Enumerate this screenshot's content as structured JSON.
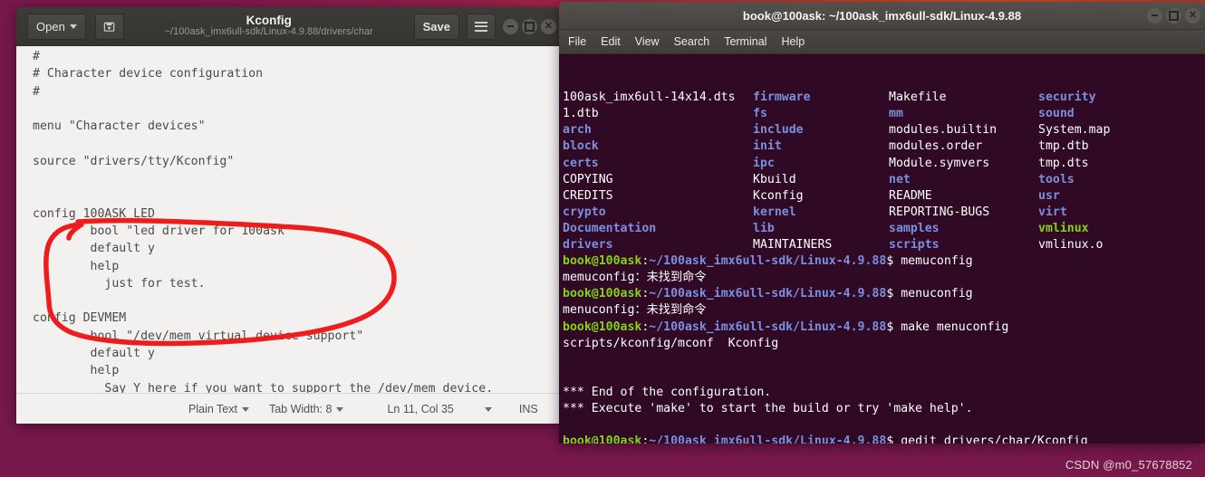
{
  "desktop": {
    "watermark": "CSDN @m0_57678852"
  },
  "gedit": {
    "title": "Kconfig",
    "subtitle": "~/100ask_imx6ull-sdk/Linux-4.9.88/drivers/char",
    "open_label": "Open",
    "save_label": "Save",
    "icons": {
      "new_document": "new-document-icon",
      "menu": "hamburger-menu-icon",
      "open_caret": "chevron-down-icon"
    },
    "window_controls": {
      "minimize": "minimize-icon",
      "maximize": "maximize-icon",
      "close": "close-icon"
    },
    "document_text": "#\n# Character device configuration\n#\n\nmenu \"Character devices\"\n\nsource \"drivers/tty/Kconfig\"\n\n\nconfig 100ASK_LED\n        bool \"led driver for 100ask\"\n        default y\n        help\n          just for test.\n\nconfig DEVMEM\n        bool \"/dev/mem virtual device support\"\n        default y\n        help\n          Say Y here if you want to support the /dev/mem device.\n          The /dev/mem device is used to access areas of physical\n          memory.",
    "statusbar": {
      "language": "Plain Text",
      "tab_width": "Tab Width: 8",
      "cursor_position": "Ln 11, Col 35",
      "insert_mode": "INS"
    },
    "annotation": {
      "shape": "hand-drawn-red-ellipse",
      "color": "#ee1c1c",
      "encircles": "config 100ASK_LED block"
    }
  },
  "terminal": {
    "title": "book@100ask: ~/100ask_imx6ull-sdk/Linux-4.9.88",
    "menu": [
      "File",
      "Edit",
      "View",
      "Search",
      "Terminal",
      "Help"
    ],
    "window_controls": {
      "minimize": "minimize-icon",
      "maximize": "maximize-icon",
      "close": "close-icon"
    },
    "prompt": {
      "user_host": "book@100ask",
      "separator": ":",
      "path": "~/100ask_imx6ull-sdk/Linux-4.9.88",
      "sigil": "$"
    },
    "ls_output": [
      [
        {
          "name": "100ask_imx6ull-14x14.dts",
          "type": "file"
        },
        {
          "name": "firmware",
          "type": "dir"
        },
        {
          "name": "Makefile",
          "type": "file"
        },
        {
          "name": "security",
          "type": "dir"
        }
      ],
      [
        {
          "name": "1.dtb",
          "type": "file"
        },
        {
          "name": "fs",
          "type": "dir"
        },
        {
          "name": "mm",
          "type": "dir"
        },
        {
          "name": "sound",
          "type": "dir"
        }
      ],
      [
        {
          "name": "arch",
          "type": "dir"
        },
        {
          "name": "include",
          "type": "dir"
        },
        {
          "name": "modules.builtin",
          "type": "file"
        },
        {
          "name": "System.map",
          "type": "file"
        }
      ],
      [
        {
          "name": "block",
          "type": "dir"
        },
        {
          "name": "init",
          "type": "dir"
        },
        {
          "name": "modules.order",
          "type": "file"
        },
        {
          "name": "tmp.dtb",
          "type": "file"
        }
      ],
      [
        {
          "name": "certs",
          "type": "dir"
        },
        {
          "name": "ipc",
          "type": "dir"
        },
        {
          "name": "Module.symvers",
          "type": "file"
        },
        {
          "name": "tmp.dts",
          "type": "file"
        }
      ],
      [
        {
          "name": "COPYING",
          "type": "file"
        },
        {
          "name": "Kbuild",
          "type": "file"
        },
        {
          "name": "net",
          "type": "dir"
        },
        {
          "name": "tools",
          "type": "dir"
        }
      ],
      [
        {
          "name": "CREDITS",
          "type": "file"
        },
        {
          "name": "Kconfig",
          "type": "file"
        },
        {
          "name": "README",
          "type": "file"
        },
        {
          "name": "usr",
          "type": "dir"
        }
      ],
      [
        {
          "name": "crypto",
          "type": "dir"
        },
        {
          "name": "kernel",
          "type": "dir"
        },
        {
          "name": "REPORTING-BUGS",
          "type": "file"
        },
        {
          "name": "virt",
          "type": "dir"
        }
      ],
      [
        {
          "name": "Documentation",
          "type": "dir"
        },
        {
          "name": "lib",
          "type": "dir"
        },
        {
          "name": "samples",
          "type": "dir"
        },
        {
          "name": "vmlinux",
          "type": "exe"
        }
      ],
      [
        {
          "name": "drivers",
          "type": "dir"
        },
        {
          "name": "MAINTAINERS",
          "type": "file"
        },
        {
          "name": "scripts",
          "type": "dir"
        },
        {
          "name": "vmlinux.o",
          "type": "file"
        }
      ]
    ],
    "session": [
      {
        "kind": "command",
        "command": "memuconfig"
      },
      {
        "kind": "output",
        "text": "memuconfig：未找到命令"
      },
      {
        "kind": "command",
        "command": "menuconfig"
      },
      {
        "kind": "output",
        "text": "menuconfig：未找到命令"
      },
      {
        "kind": "command",
        "command": "make menuconfig"
      },
      {
        "kind": "output",
        "text": "scripts/kconfig/mconf  Kconfig"
      },
      {
        "kind": "output",
        "text": ""
      },
      {
        "kind": "output",
        "text": ""
      },
      {
        "kind": "output",
        "text": "*** End of the configuration."
      },
      {
        "kind": "output",
        "text": "*** Execute 'make' to start the build or try 'make help'."
      },
      {
        "kind": "output",
        "text": ""
      },
      {
        "kind": "command",
        "command": "gedit drivers/char/Kconfig"
      },
      {
        "kind": "command",
        "command": "gedit drivers/char/Kconfig"
      }
    ]
  }
}
